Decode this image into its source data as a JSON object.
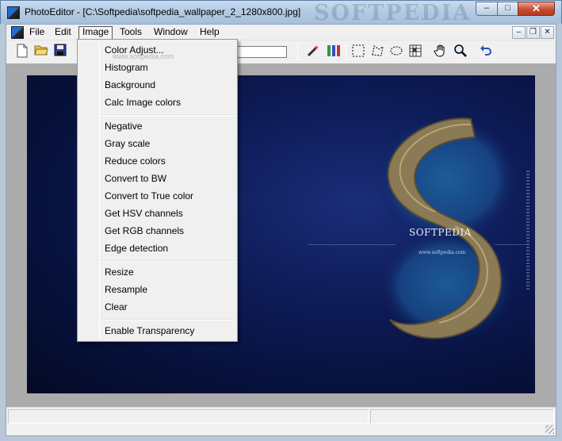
{
  "window": {
    "title": "PhotoEditor - [C:\\Softpedia\\softpedia_wallpaper_2_1280x800.jpg]",
    "watermark": "SOFTPEDIA",
    "buttons": {
      "minimize": "–",
      "maximize": "□",
      "close": "✕"
    }
  },
  "menubar": {
    "items": [
      "File",
      "Edit",
      "Image",
      "Tools",
      "Window",
      "Help"
    ],
    "active": "Image",
    "mdi_buttons": {
      "minimize": "–",
      "restore": "❐",
      "close": "✕"
    }
  },
  "toolbar": {
    "icons": [
      "new-file-icon",
      "open-folder-icon",
      "save-disk-icon",
      "magic-wand-icon",
      "color-pencils-icon",
      "rect-select-icon",
      "lasso-select-icon",
      "ellipse-select-icon",
      "pattern-icon",
      "hand-pan-icon",
      "zoom-icon",
      "undo-icon"
    ],
    "zoom_value": ""
  },
  "image_menu": {
    "groups": [
      [
        "Color Adjust...",
        "Histogram",
        "Background",
        "Calc Image colors"
      ],
      [
        "Negative",
        "Gray scale",
        "Reduce colors",
        "Convert to BW",
        "Convert to True color",
        "Get HSV channels",
        "Get RGB channels",
        "Edge detection"
      ],
      [
        "Resize",
        "Resample",
        "Clear"
      ],
      [
        "Enable Transparency"
      ]
    ],
    "watermark": "www.softpedia.com"
  },
  "canvas": {
    "brand_text": "SOFTPEDIA",
    "url_text": "www.softpedia.com"
  },
  "colors": {
    "canvas_bg": "#0d1a55",
    "workspace_bg": "#ababab",
    "menu_bg": "#f0f0f0"
  }
}
